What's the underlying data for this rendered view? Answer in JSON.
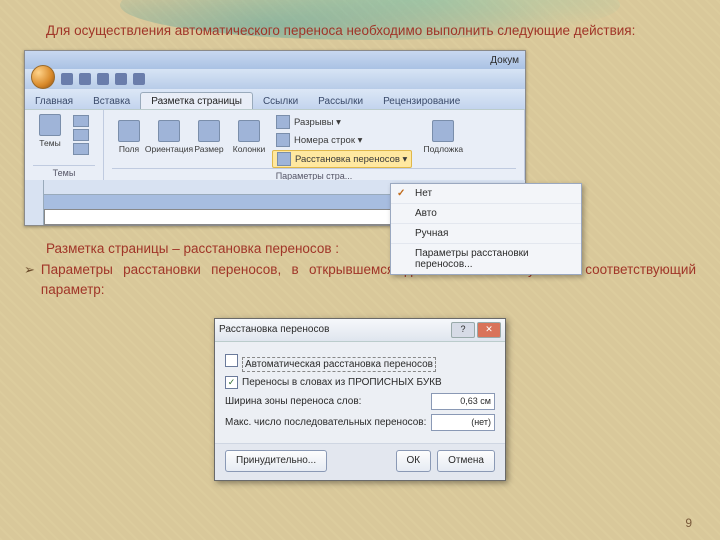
{
  "lead": "Для осуществления автоматического переноса необходимо выполнить следующие действия:",
  "word": {
    "doc_label": "Докум",
    "tabs": [
      "Главная",
      "Вставка",
      "Разметка страницы",
      "Ссылки",
      "Рассылки",
      "Рецензирование"
    ],
    "group_themes": "Темы",
    "themes_btn": "Темы",
    "group_page": "Параметры стра...",
    "page_btns": [
      "Поля",
      "Ориентация",
      "Размер",
      "Колонки"
    ],
    "breaks": "Разрывы ▾",
    "line_numbers": "Номера строк ▾",
    "hyphenation": "Расстановка переносов ▾",
    "watermark": "Подложка",
    "menu": {
      "none": "Нет",
      "auto": "Авто",
      "manual": "Ручная",
      "options": "Параметры расстановки переносов..."
    }
  },
  "sec2_intro": "Разметка страницы – расстановка переносов :",
  "sec2_bullet": "Параметры расстановки переносов, в открывшемся диалоговом окне указать соответствующий параметр:",
  "dialog": {
    "title": "Расстановка переносов",
    "auto": "Автоматическая расстановка переносов",
    "caps": "Переносы в словах из ПРОПИСНЫХ БУКВ",
    "zone_label": "Ширина зоны переноса слов:",
    "zone_value": "0,63 см",
    "max_label": "Макс. число последовательных переносов:",
    "max_value": "(нет)",
    "force": "Принудительно...",
    "ok": "ОК",
    "cancel": "Отмена",
    "help": "?"
  },
  "pagenum": "9"
}
